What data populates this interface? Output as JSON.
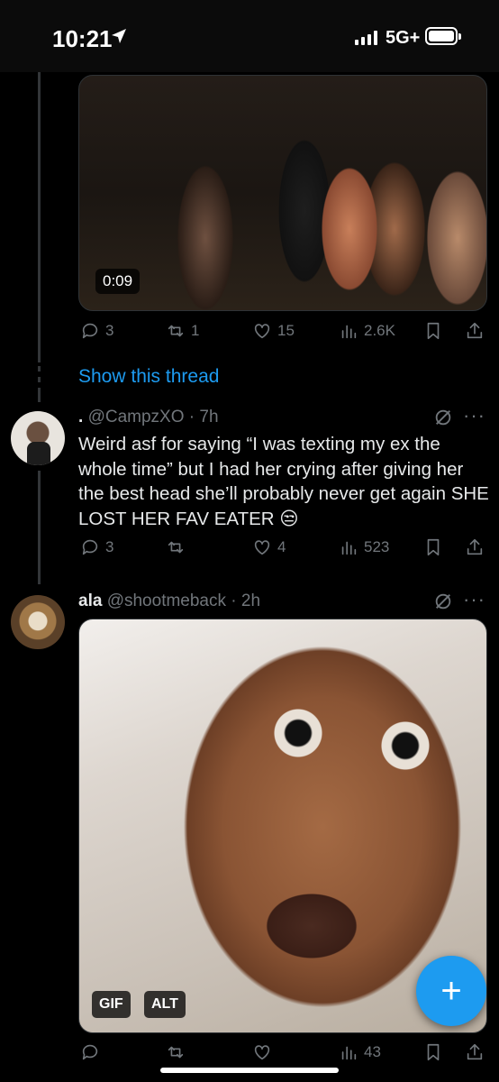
{
  "status_bar": {
    "time": "10:21",
    "network": "5G+",
    "icons": [
      "location-arrow-icon",
      "signal-icon",
      "battery-icon"
    ]
  },
  "tweet1": {
    "video_duration": "0:09",
    "actions": {
      "replies": "3",
      "reposts": "1",
      "likes": "15",
      "views": "2.6K"
    },
    "show_thread": "Show this thread"
  },
  "tweet2": {
    "name": ".",
    "handle": "@CampzXO",
    "time": "7h",
    "text": "Weird asf for saying “I was texting my ex the whole time” but I had her crying after giving her the best head she’ll probably never get again SHE LOST HER FAV EATER 😒",
    "actions": {
      "replies": "3",
      "reposts": "",
      "likes": "4",
      "views": "523"
    }
  },
  "tweet3": {
    "name": "ala",
    "handle": "@shootmeback",
    "time": "2h",
    "media_badges": {
      "gif": "GIF",
      "alt": "ALT"
    },
    "actions": {
      "replies": "",
      "reposts": "",
      "likes": "",
      "views": "43"
    }
  },
  "fab": {
    "label": "+"
  },
  "colors": {
    "accent": "#1d9bf0",
    "muted": "#71767b",
    "text": "#e7e9ea",
    "background": "#000000"
  }
}
